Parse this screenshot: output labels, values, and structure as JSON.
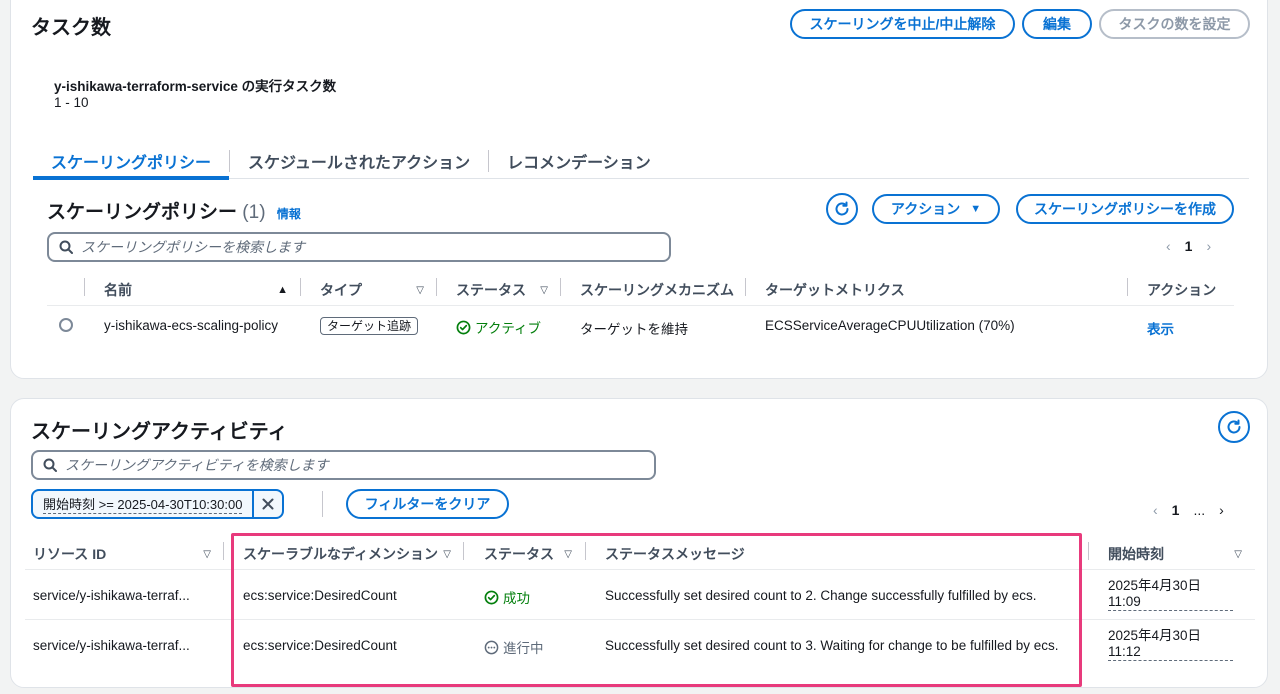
{
  "tasks_panel": {
    "title": "タスク数",
    "buttons": {
      "suspend": "スケーリングを中止/中止解除",
      "edit": "編集",
      "set_count": "タスクの数を設定"
    },
    "service_label": "y-ishikawa-terraform-service の実行タスク数",
    "task_range": "1 - 10",
    "tabs": [
      "スケーリングポリシー",
      "スケジュールされたアクション",
      "レコメンデーション"
    ],
    "policies": {
      "title": "スケーリングポリシー",
      "count": "(1)",
      "info": "情報",
      "actions_button": "アクション",
      "create_button": "スケーリングポリシーを作成",
      "search_placeholder": "スケーリングポリシーを検索します",
      "page": "1",
      "columns": [
        "名前",
        "タイプ",
        "ステータス",
        "スケーリングメカニズム",
        "ターゲットメトリクス",
        "アクション"
      ],
      "rows": [
        {
          "name": "y-ishikawa-ecs-scaling-policy",
          "type": "ターゲット追跡",
          "status": "アクティブ",
          "mechanism": "ターゲットを維持",
          "metric": "ECSServiceAverageCPUUtilization (70%)",
          "action": "表示"
        }
      ]
    }
  },
  "activity_panel": {
    "title": "スケーリングアクティビティ",
    "search_placeholder": "スケーリングアクティビティを検索します",
    "filter_token": "開始時刻 >= 2025-04-30T10:30:00",
    "clear_filter": "フィルターをクリア",
    "page": "1",
    "ellipsis": "...",
    "columns": [
      "リソース ID",
      "スケーラブルなディメンション",
      "ステータス",
      "ステータスメッセージ",
      "開始時刻"
    ],
    "rows": [
      {
        "resource": "service/y-ishikawa-terraf...",
        "dimension": "ecs:service:DesiredCount",
        "status": "成功",
        "message": "Successfully set desired count to 2. Change successfully fulfilled by ecs.",
        "start_date": "2025年4月30日",
        "start_time": "11:09"
      },
      {
        "resource": "service/y-ishikawa-terraf...",
        "dimension": "ecs:service:DesiredCount",
        "status": "進行中",
        "message": "Successfully set desired count to 3. Waiting for change to be fulfilled by ecs.",
        "start_date": "2025年4月30日",
        "start_time": "11:12"
      }
    ]
  },
  "colors": {
    "accent": "#0972d3",
    "success": "#037f0c",
    "highlight": "#e83a7c"
  }
}
